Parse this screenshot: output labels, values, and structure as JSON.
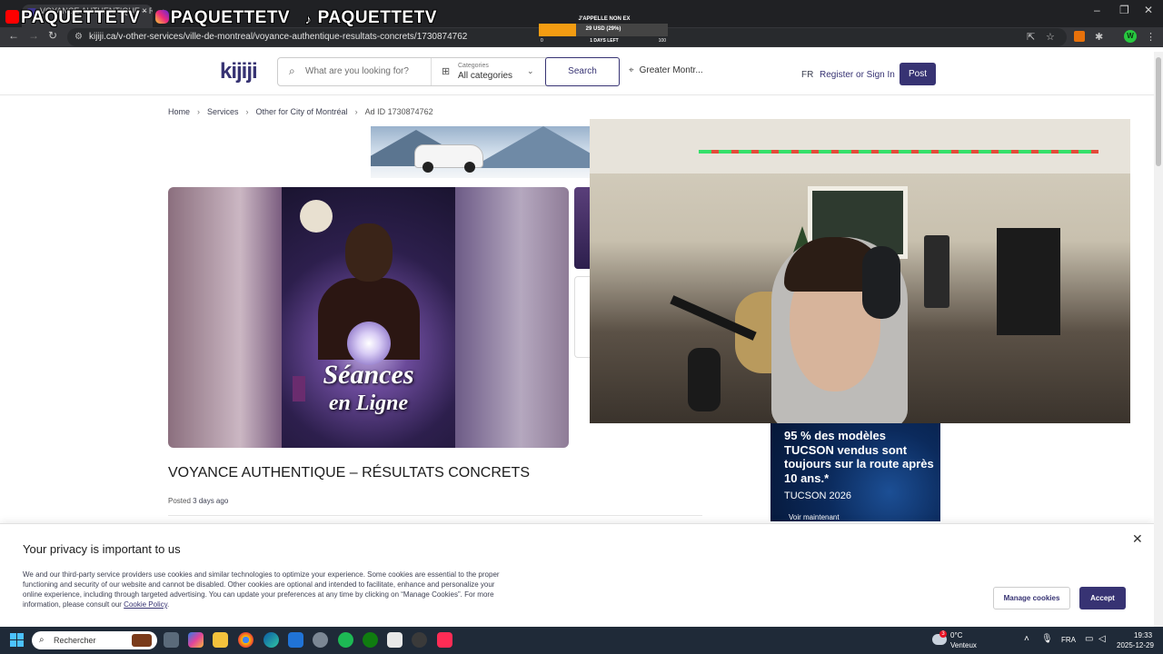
{
  "browser": {
    "tab_title": "VOYANCE AUTHENTIQUE – RÉS",
    "url": "kijiji.ca/v-other-services/ville-de-montreal/voyance-authentique-resultats-concrets/1730874762",
    "profile_initial": "W"
  },
  "overlay": {
    "brands": [
      "PAQUETTETV",
      "PAQUETTETV",
      "PAQUETTETV"
    ],
    "goal": {
      "title": "J'APPELLE NON EX",
      "progress_text": "29 USD (29%)",
      "progress_fraction": 0.29,
      "min": "0",
      "max": "100",
      "days_left": "1 DAYS LEFT"
    }
  },
  "site": {
    "logo": "kijiji",
    "search_placeholder": "What are you looking for?",
    "categories_label": "Categories",
    "categories_value": "All categories",
    "search_button": "Search",
    "location": "Greater Montr...",
    "lang": "FR",
    "register": "Register or Sign In",
    "post": "Post"
  },
  "breadcrumb": {
    "home": "Home",
    "services": "Services",
    "category": "Other for City of Montréal",
    "ad_id": "Ad ID 1730874762"
  },
  "gallery": {
    "caption_line1": "Séances",
    "caption_line2": "en Ligne"
  },
  "listing": {
    "title": "VOYANCE AUTHENTIQUE – RÉSULTATS CONCRETS",
    "posted_prefix": "Posted ",
    "posted_value": "3 days ago"
  },
  "side_ad": {
    "text": "95 % des modèles TUCSON vendus sont toujours sur la route après 10 ans.*",
    "model": "TUCSON 2026",
    "cta": "Voir maintenant"
  },
  "cookie": {
    "title": "Your privacy is important to us",
    "body": "We and our third-party service providers use cookies and similar technologies to optimize your experience. Some cookies are essential to the proper functioning and security of our website and cannot be disabled. Other cookies are optional and intended to facilitate, enhance and personalize your online experience, including through targeted advertising. You can update your preferences at any time by clicking on “Manage Cookies”. For more information, please consult our ",
    "policy_link": "Cookie Policy",
    "policy_suffix": ".",
    "manage": "Manage cookies",
    "accept": "Accept"
  },
  "taskbar": {
    "search": "Rechercher",
    "weather_temp": "0°C",
    "weather_desc": "Venteux",
    "weather_badge": "3",
    "lang": "FRA",
    "time": "19:33",
    "date": "2025-12-29"
  }
}
